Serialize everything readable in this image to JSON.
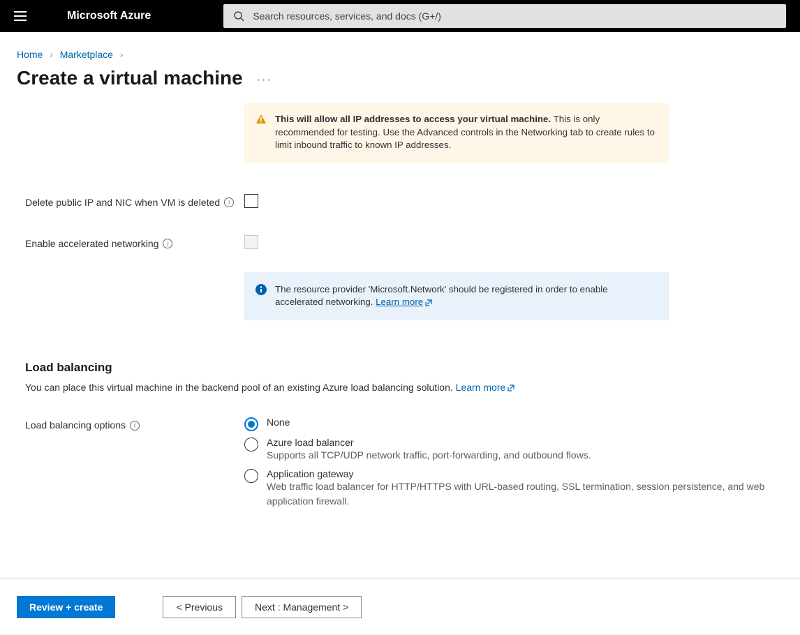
{
  "header": {
    "brand": "Microsoft Azure",
    "search_placeholder": "Search resources, services, and docs (G+/)"
  },
  "breadcrumb": {
    "home": "Home",
    "marketplace": "Marketplace"
  },
  "page_title": "Create a virtual machine",
  "warning": {
    "bold": "This will allow all IP addresses to access your virtual machine.",
    "rest": " This is only recommended for testing.  Use the Advanced controls in the Networking tab to create rules to limit inbound traffic to known IP addresses."
  },
  "fields": {
    "delete_public_ip_label": "Delete public IP and NIC when VM is deleted",
    "enable_accelerated_label": "Enable accelerated networking"
  },
  "info": {
    "text": "The resource provider 'Microsoft.Network' should be registered in order to enable accelerated networking. ",
    "learn_more": "Learn more"
  },
  "load_balancing": {
    "heading": "Load balancing",
    "desc": "You can place this virtual machine in the backend pool of an existing Azure load balancing solution. ",
    "learn_more": "Learn more",
    "label": "Load balancing options",
    "options": {
      "none": {
        "label": "None"
      },
      "alb": {
        "label": "Azure load balancer",
        "desc": "Supports all TCP/UDP network traffic, port-forwarding, and outbound flows."
      },
      "agw": {
        "label": "Application gateway",
        "desc": "Web traffic load balancer for HTTP/HTTPS with URL-based routing, SSL termination, session persistence, and web application firewall."
      }
    }
  },
  "footer": {
    "review_create": "Review + create",
    "previous": "< Previous",
    "next": "Next : Management >"
  }
}
